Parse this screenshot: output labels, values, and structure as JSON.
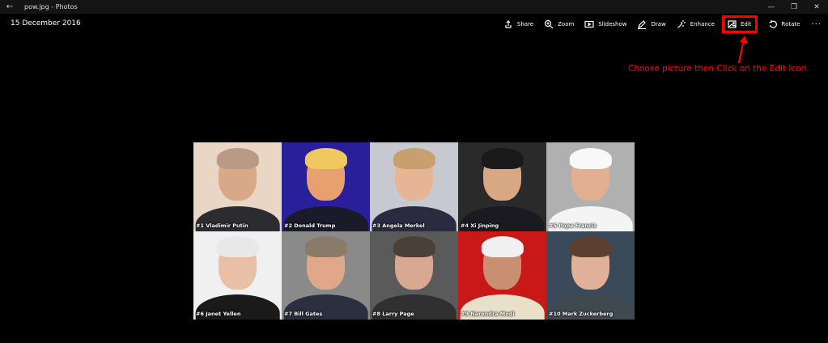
{
  "window": {
    "title": "pow.jpg - Photos",
    "back_icon": "back-arrow-icon",
    "controls": [
      "minimize-icon",
      "restore-icon",
      "close-icon"
    ]
  },
  "photo": {
    "date": "15 December 2016"
  },
  "toolbar": {
    "share": "Share",
    "zoom": "Zoom",
    "slideshow": "Slideshow",
    "draw": "Draw",
    "enhance": "Enhance",
    "edit": "Edit",
    "rotate": "Rotate",
    "more": "···"
  },
  "annotation": {
    "text": "Choose picture then Click on the Edit Icon.",
    "color": "#ff0000"
  },
  "grid": [
    {
      "caption": "#1 Vladimir Putin",
      "bg": "#e9d6c4",
      "skin": "#d9a888",
      "hair": "#b89a86",
      "suit": "#2c2c30"
    },
    {
      "caption": "#2 Donald Trump",
      "bg": "#2a1f9a",
      "skin": "#e8a070",
      "hair": "#f0c860",
      "suit": "#1a1a2a"
    },
    {
      "caption": "#3 Angela Merkel",
      "bg": "#c8c8d0",
      "skin": "#e6b596",
      "hair": "#c8a070",
      "suit": "#2a2a40"
    },
    {
      "caption": "#4 Xi Jinping",
      "bg": "#2a2a2a",
      "skin": "#d8a882",
      "hair": "#1a1a1a",
      "suit": "#1a1a20"
    },
    {
      "caption": "#5 Pope Francis",
      "bg": "#b0b0b0",
      "skin": "#e2b090",
      "hair": "#f8f8f8",
      "suit": "#f4f4f4"
    },
    {
      "caption": "#6 Janet Yellen",
      "bg": "#f0f0f0",
      "skin": "#e8c0a8",
      "hair": "#e8e8e8",
      "suit": "#1a1a1a"
    },
    {
      "caption": "#7 Bill Gates",
      "bg": "#8a8a8a",
      "skin": "#e0a888",
      "hair": "#8a7a6a",
      "suit": "#2a3040"
    },
    {
      "caption": "#8 Larry Page",
      "bg": "#5a5a5a",
      "skin": "#d8a890",
      "hair": "#4a4038",
      "suit": "#303030"
    },
    {
      "caption": "#9 Narendra Modi",
      "bg": "#c81818",
      "skin": "#c89070",
      "hair": "#f0f0f0",
      "suit": "#e8e0c8"
    },
    {
      "caption": "#10 Mark Zuckerberg",
      "bg": "#3a4a5a",
      "skin": "#e0b098",
      "hair": "#5a4030",
      "suit": "#404850"
    }
  ]
}
